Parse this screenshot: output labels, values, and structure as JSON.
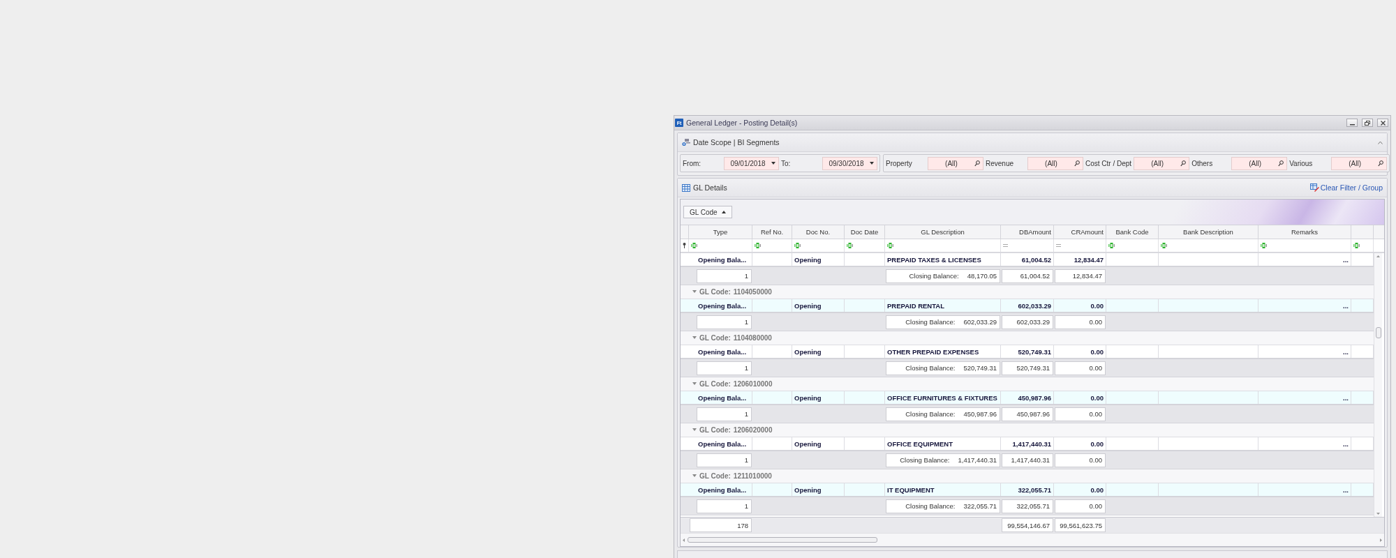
{
  "window": {
    "title": "General Ledger - Posting Detail(s)",
    "icon_text": "Ft"
  },
  "date_scope": {
    "title": "Date Scope | BI Segments",
    "from_label": "From:",
    "from_value": "09/01/2018",
    "to_label": "To:",
    "to_value": "09/30/2018",
    "segments": [
      {
        "label": "Property",
        "value": "(All)"
      },
      {
        "label": "Revenue",
        "value": "(All)"
      },
      {
        "label": "Cost Ctr / Dept",
        "value": "(All)"
      },
      {
        "label": "Others",
        "value": "(All)"
      },
      {
        "label": "Various",
        "value": "(All)"
      }
    ]
  },
  "gl_details": {
    "title": "GL Details",
    "clear_link": "Clear Filter / Group",
    "group_by": "GL Code",
    "columns": [
      "Type",
      "Ref No.",
      "Doc No.",
      "Doc Date",
      "GL Description",
      "DBAmount",
      "CRAmount",
      "Bank Code",
      "Bank Description",
      "Remarks"
    ],
    "groups": [
      {
        "rows": [
          {
            "type": "Opening Bala...",
            "doc_no": "Opening",
            "description": "PREPAID TAXES & LICENSES",
            "db": "61,004.52",
            "cr": "12,834.47",
            "remarks": "..."
          }
        ],
        "summary": {
          "count": "1",
          "closing_label": "Closing Balance:",
          "closing_value": "48,170.05",
          "db": "61,004.52",
          "cr": "12,834.47"
        }
      },
      {
        "label": "GL Code:",
        "code": "1104050000",
        "expanded": true,
        "rows": [
          {
            "type": "Opening Bala...",
            "doc_no": "Opening",
            "description": "PREPAID RENTAL",
            "db": "602,033.29",
            "cr": "0.00",
            "remarks": "..."
          }
        ],
        "summary": {
          "count": "1",
          "closing_label": "Closing Balance:",
          "closing_value": "602,033.29",
          "db": "602,033.29",
          "cr": "0.00"
        }
      },
      {
        "label": "GL Code:",
        "code": "1104080000",
        "expanded": true,
        "rows": [
          {
            "type": "Opening Bala...",
            "doc_no": "Opening",
            "description": "OTHER PREPAID EXPENSES",
            "db": "520,749.31",
            "cr": "0.00",
            "remarks": "..."
          }
        ],
        "summary": {
          "count": "1",
          "closing_label": "Closing Balance:",
          "closing_value": "520,749.31",
          "db": "520,749.31",
          "cr": "0.00"
        }
      },
      {
        "label": "GL Code:",
        "code": "1206010000",
        "expanded": true,
        "rows": [
          {
            "type": "Opening Bala...",
            "doc_no": "Opening",
            "description": "OFFICE FURNITURES & FIXTURES",
            "db": "450,987.96",
            "cr": "0.00",
            "remarks": "..."
          }
        ],
        "summary": {
          "count": "1",
          "closing_label": "Closing Balance:",
          "closing_value": "450,987.96",
          "db": "450,987.96",
          "cr": "0.00"
        }
      },
      {
        "label": "GL Code:",
        "code": "1206020000",
        "expanded": true,
        "rows": [
          {
            "type": "Opening Bala...",
            "doc_no": "Opening",
            "description": "OFFICE EQUIPMENT",
            "db": "1,417,440.31",
            "cr": "0.00",
            "remarks": "..."
          }
        ],
        "summary": {
          "count": "1",
          "closing_label": "Closing Balance:",
          "closing_value": "1,417,440.31",
          "db": "1,417,440.31",
          "cr": "0.00"
        }
      },
      {
        "label": "GL Code:",
        "code": "1211010000",
        "expanded": true,
        "rows": [
          {
            "type": "Opening Bala...",
            "doc_no": "Opening",
            "description": "IT EQUIPMENT",
            "db": "322,055.71",
            "cr": "0.00",
            "remarks": "..."
          }
        ],
        "summary": {
          "count": "1",
          "closing_label": "Closing Balance:",
          "closing_value": "322,055.71",
          "db": "322,055.71",
          "cr": "0.00"
        }
      }
    ],
    "totals": {
      "count": "178",
      "db": "99,554,146.67",
      "cr": "99,561,623.75"
    }
  }
}
